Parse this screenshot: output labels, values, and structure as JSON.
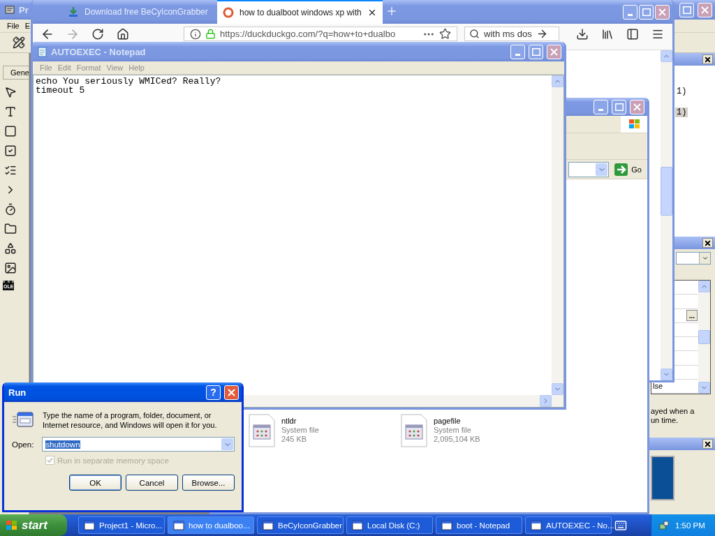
{
  "vb_window": {
    "title": "Pr",
    "active": false,
    "menu": [
      "File",
      "E"
    ],
    "toolbox_tab": "Gene",
    "toolbox_ole": "OLE",
    "project_items": [
      {
        "label": "1)",
        "selected": false
      },
      {
        "label": "1)",
        "selected": true
      }
    ],
    "ellipsis_button": "...",
    "property_value": "lse",
    "description": [
      "ayed when a",
      "un time."
    ]
  },
  "browser": {
    "active": false,
    "tabs": [
      {
        "label": "Download free BeCyIconGrabber",
        "selected": false
      },
      {
        "label": "how to dualboot windows xp with",
        "selected": true
      }
    ],
    "url": "https://duckduckgo.com/?q=how+to+dualbo",
    "search": "with ms dos"
  },
  "explorer": {
    "active": false,
    "go": "Go",
    "files": [
      {
        "name": "ntldr",
        "type": "System file",
        "size": "245 KB"
      },
      {
        "name": "pagefile",
        "type": "System file",
        "size": "2,095,104 KB"
      }
    ]
  },
  "notepad": {
    "title": "AUTOEXEC - Notepad",
    "active": false,
    "menu": [
      "File",
      "Edit",
      "Format",
      "View",
      "Help"
    ],
    "lines": [
      "echo You seriously WMICed? Really?",
      "timeout 5"
    ]
  },
  "run_dialog": {
    "title": "Run",
    "active": true,
    "help_button": "?",
    "prompt": "Type the name of a program, folder, document, or Internet resource, and Windows will open it for you.",
    "open_label": "Open:",
    "value": "shutdown",
    "separate_memory": {
      "label": "Run in separate memory space",
      "checked": true,
      "disabled": true
    },
    "buttons": [
      "OK",
      "Cancel",
      "Browse..."
    ]
  },
  "taskbar": {
    "start": "start",
    "items": [
      {
        "label": "Project1 - Micro...",
        "selected": false
      },
      {
        "label": "how to dualboo...",
        "selected": true
      },
      {
        "label": "BeCyIconGrabber",
        "selected": false
      },
      {
        "label": "Local Disk (C:)",
        "selected": false
      },
      {
        "label": "boot - Notepad",
        "selected": false
      },
      {
        "label": "AUTOEXEC - No...",
        "selected": false
      }
    ],
    "clock": "1:50 PM"
  }
}
